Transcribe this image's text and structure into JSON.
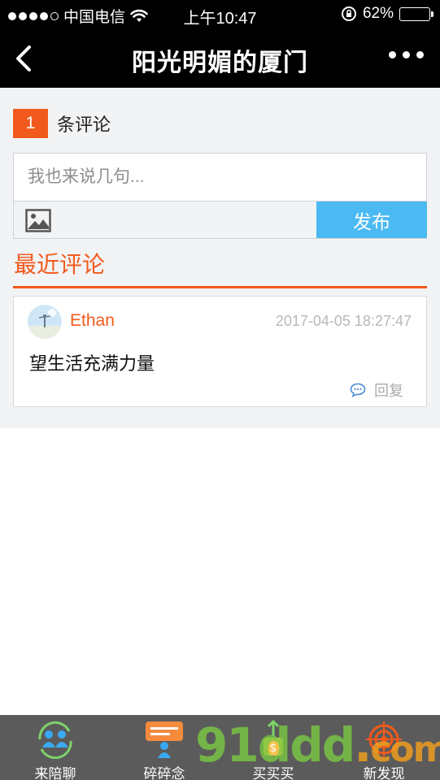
{
  "status_bar": {
    "carrier": "中国电信",
    "time": "上午10:47",
    "battery_percent": "62%",
    "battery_level": 0.62,
    "signal_bars_filled": 4,
    "signal_bars_total": 5
  },
  "nav": {
    "title": "阳光明媚的厦门",
    "back_icon": "chevron-left-icon",
    "more_icon": "more-dots-icon"
  },
  "comments_header": {
    "count": "1",
    "count_label": "条评论"
  },
  "comment_input": {
    "placeholder": "我也来说几句..."
  },
  "toolbar": {
    "image_icon": "image-icon",
    "publish_label": "发布"
  },
  "recent": {
    "title": "最近评论"
  },
  "comments": [
    {
      "user": "Ethan",
      "time": "2017-04-05 18:27:47",
      "text": "望生活充满力量",
      "reply_label": "回复"
    }
  ],
  "tabs": [
    {
      "label": "来陪聊",
      "icon": "people-icon"
    },
    {
      "label": "碎碎念",
      "icon": "chat-bubble-icon"
    },
    {
      "label": "买买买",
      "icon": "shopping-bag-icon"
    },
    {
      "label": "新发现",
      "icon": "target-icon"
    }
  ],
  "watermark": {
    "text": "91ddd",
    "suffix": "com"
  },
  "colors": {
    "accent": "#f15a1c",
    "publish": "#4cbaf2",
    "tabbar": "#5b5b5b",
    "background": "#f2f3f5"
  }
}
